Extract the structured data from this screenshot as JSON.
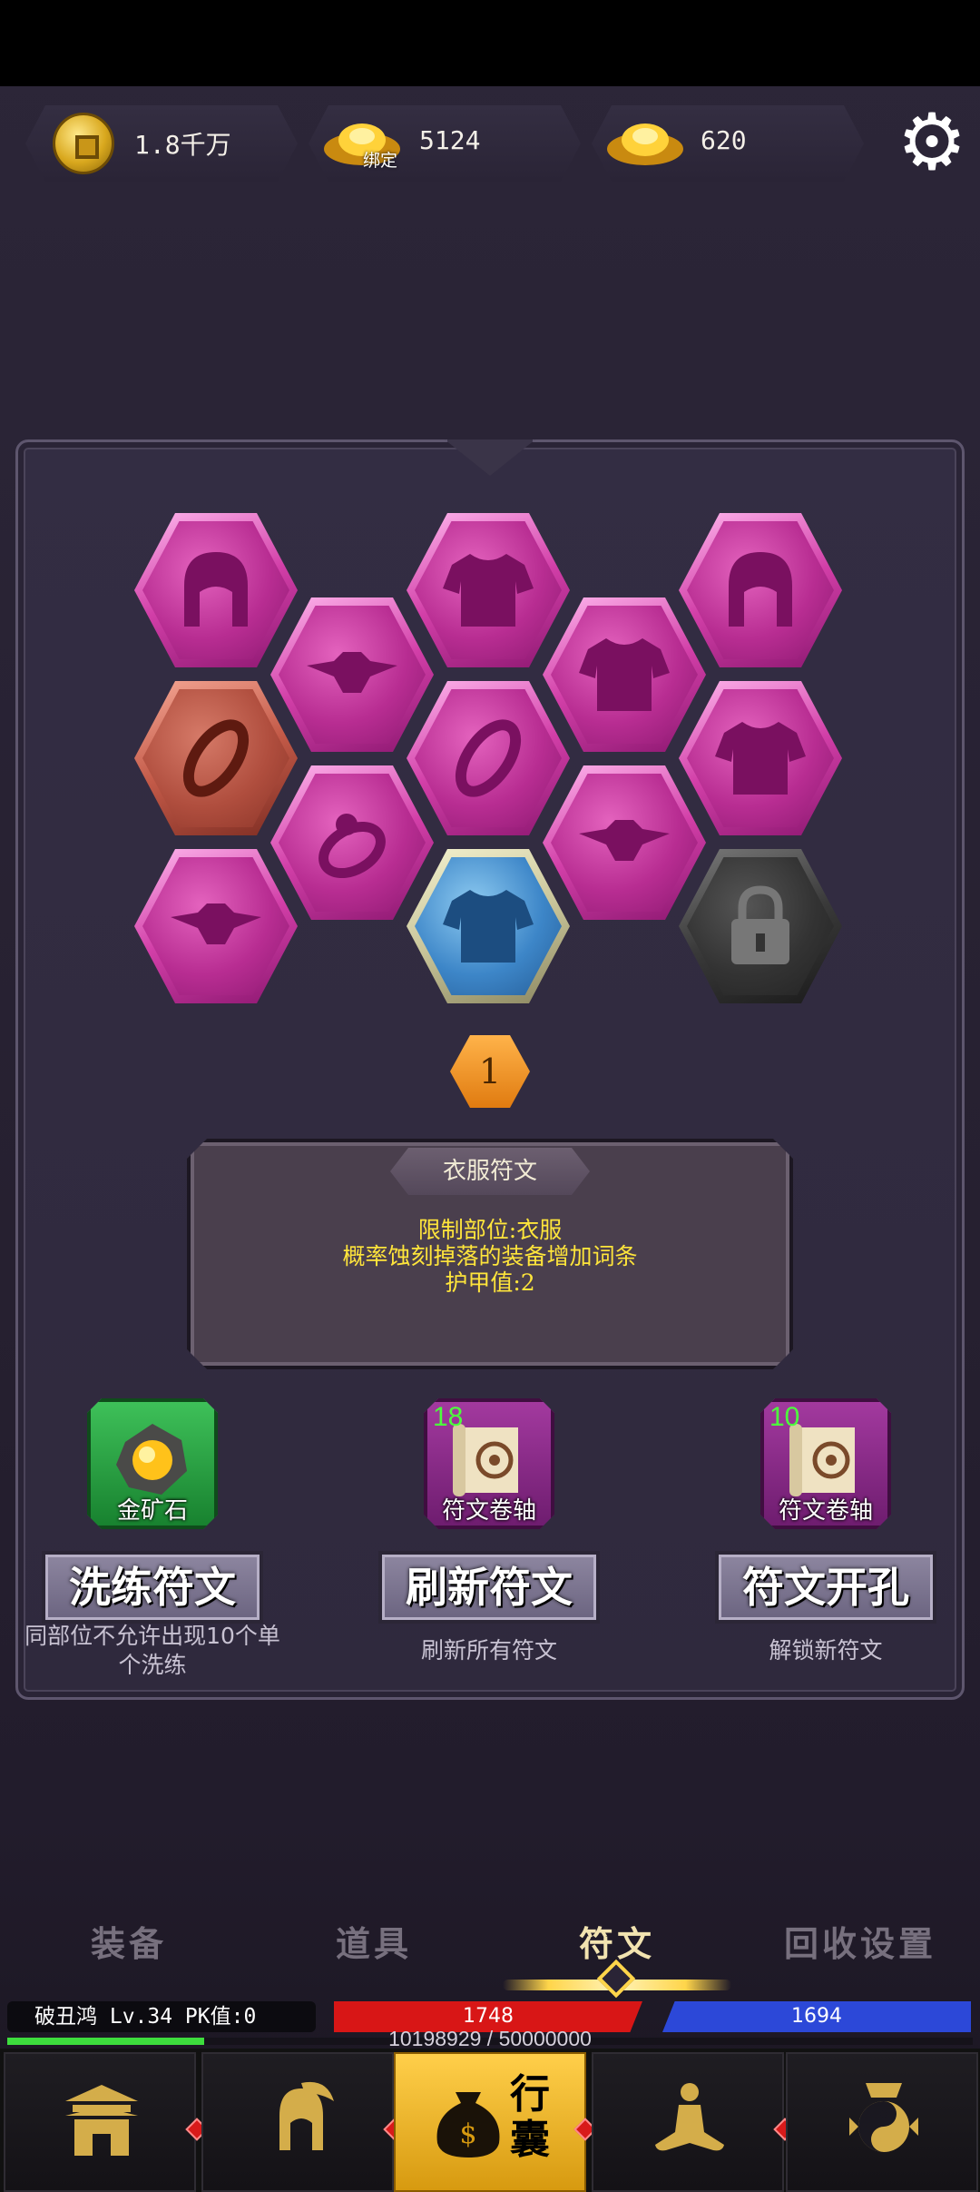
{
  "currency": {
    "copper": "1.8千万",
    "bound_gold_label": "绑定",
    "bound_gold": "5124",
    "gold": "620"
  },
  "rune_grid": {
    "selected_level": "1",
    "slots": [
      {
        "type": "helmet",
        "color": "pink"
      },
      {
        "type": "armor",
        "color": "pink"
      },
      {
        "type": "helmet",
        "color": "pink"
      },
      {
        "type": "belt",
        "color": "pink"
      },
      {
        "type": "armor",
        "color": "pink"
      },
      {
        "type": "ring",
        "color": "red"
      },
      {
        "type": "ring",
        "color": "pink"
      },
      {
        "type": "armor",
        "color": "pink"
      },
      {
        "type": "ring-small",
        "color": "pink"
      },
      {
        "type": "belt",
        "color": "pink"
      },
      {
        "type": "belt",
        "color": "pink"
      },
      {
        "type": "armor",
        "color": "blue",
        "selected": true
      },
      {
        "type": "lock",
        "color": "gray",
        "locked": true
      }
    ]
  },
  "description": {
    "title": "衣服符文",
    "line1": "限制部位:衣服",
    "line2": "概率蚀刻掉落的装备增加词条",
    "line3": "护甲值:2"
  },
  "actions": [
    {
      "item_name": "金矿石",
      "item_count": "",
      "button": "洗练符文",
      "hint": "同部位不允许出现10个单个洗练"
    },
    {
      "item_name": "符文卷轴",
      "item_count": "18",
      "button": "刷新符文",
      "hint": "刷新所有符文"
    },
    {
      "item_name": "符文卷轴",
      "item_count": "10",
      "button": "符文开孔",
      "hint": "解锁新符文"
    }
  ],
  "tabs": [
    "装备",
    "道具",
    "符文",
    "回收设置"
  ],
  "active_tab": "符文",
  "player": {
    "info": "破丑鸿  Lv.34 PK值:0",
    "hp": "1748",
    "mp": "1694",
    "xp_text": "10198929 / 50000000",
    "xp_fraction": 0.204
  },
  "nav": {
    "active_label": "行囊"
  },
  "colors": {
    "accent": "#ffd54a",
    "hp": "#d81616",
    "mp": "#2c48d8"
  }
}
